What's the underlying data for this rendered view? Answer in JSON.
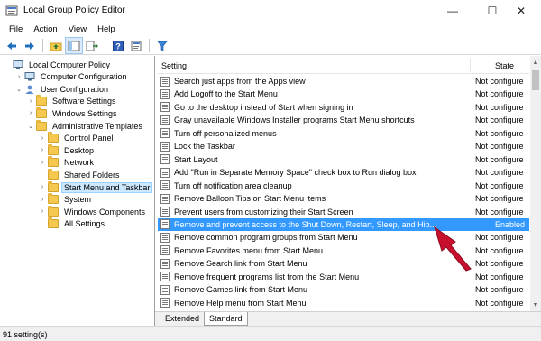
{
  "window": {
    "title": "Local Group Policy Editor",
    "minimize_glyph": "—",
    "maximize_glyph": "☐",
    "close_glyph": "✕"
  },
  "menu": [
    "File",
    "Action",
    "View",
    "Help"
  ],
  "toolbar": {
    "buttons": [
      "back-arrow-icon",
      "forward-arrow-icon",
      "up-folder-icon",
      "show-hide-tree-icon",
      "export-list-icon",
      "help-icon",
      "properties-icon",
      "filter-icon"
    ]
  },
  "tree": [
    {
      "label": "Local Computer Policy",
      "indent": 0,
      "expander": "",
      "icon": "computer"
    },
    {
      "label": "Computer Configuration",
      "indent": 1,
      "expander": ">",
      "icon": "computer"
    },
    {
      "label": "User Configuration",
      "indent": 1,
      "expander": "v",
      "icon": "user"
    },
    {
      "label": "Software Settings",
      "indent": 2,
      "expander": ">",
      "icon": "folder"
    },
    {
      "label": "Windows Settings",
      "indent": 2,
      "expander": ">",
      "icon": "folder"
    },
    {
      "label": "Administrative Templates",
      "indent": 2,
      "expander": "v",
      "icon": "folder"
    },
    {
      "label": "Control Panel",
      "indent": 3,
      "expander": ">",
      "icon": "folder"
    },
    {
      "label": "Desktop",
      "indent": 3,
      "expander": ">",
      "icon": "folder"
    },
    {
      "label": "Network",
      "indent": 3,
      "expander": ">",
      "icon": "folder"
    },
    {
      "label": "Shared Folders",
      "indent": 3,
      "expander": "",
      "icon": "folder"
    },
    {
      "label": "Start Menu and Taskbar",
      "indent": 3,
      "expander": ">",
      "icon": "folder",
      "selected": true
    },
    {
      "label": "System",
      "indent": 3,
      "expander": ">",
      "icon": "folder"
    },
    {
      "label": "Windows Components",
      "indent": 3,
      "expander": ">",
      "icon": "folder"
    },
    {
      "label": "All Settings",
      "indent": 3,
      "expander": "",
      "icon": "folder"
    }
  ],
  "list": {
    "header_setting": "Setting",
    "header_state": "State",
    "rows": [
      {
        "setting": "Search just apps from the Apps view",
        "state": "Not configure"
      },
      {
        "setting": "Add Logoff to the Start Menu",
        "state": "Not configure"
      },
      {
        "setting": "Go to the desktop instead of Start when signing in",
        "state": "Not configure"
      },
      {
        "setting": "Gray unavailable Windows Installer programs Start Menu shortcuts",
        "state": "Not configure"
      },
      {
        "setting": "Turn off personalized menus",
        "state": "Not configure"
      },
      {
        "setting": "Lock the Taskbar",
        "state": "Not configure"
      },
      {
        "setting": "Start Layout",
        "state": "Not configure"
      },
      {
        "setting": "Add \"Run in Separate Memory Space\" check box to Run dialog box",
        "state": "Not configure"
      },
      {
        "setting": "Turn off notification area cleanup",
        "state": "Not configure"
      },
      {
        "setting": "Remove Balloon Tips on Start Menu items",
        "state": "Not configure"
      },
      {
        "setting": "Prevent users from customizing their Start Screen",
        "state": "Not configure"
      },
      {
        "setting": "Remove and prevent access to the Shut Down, Restart, Sleep, and Hib...",
        "state": "Enabled",
        "selected": true
      },
      {
        "setting": "Remove common program groups from Start Menu",
        "state": "Not configure"
      },
      {
        "setting": "Remove Favorites menu from Start Menu",
        "state": "Not configure"
      },
      {
        "setting": "Remove Search link from Start Menu",
        "state": "Not configure"
      },
      {
        "setting": "Remove frequent programs list from the Start Menu",
        "state": "Not configure"
      },
      {
        "setting": "Remove Games link from Start Menu",
        "state": "Not configure"
      },
      {
        "setting": "Remove Help menu from Start Menu",
        "state": "Not configure"
      }
    ]
  },
  "tabs": [
    "Extended",
    "Standard"
  ],
  "status": "91 setting(s)",
  "colors": {
    "selection": "#3399ff",
    "tree_selection": "#cce8ff",
    "annotation_arrow": "#c8102e"
  }
}
